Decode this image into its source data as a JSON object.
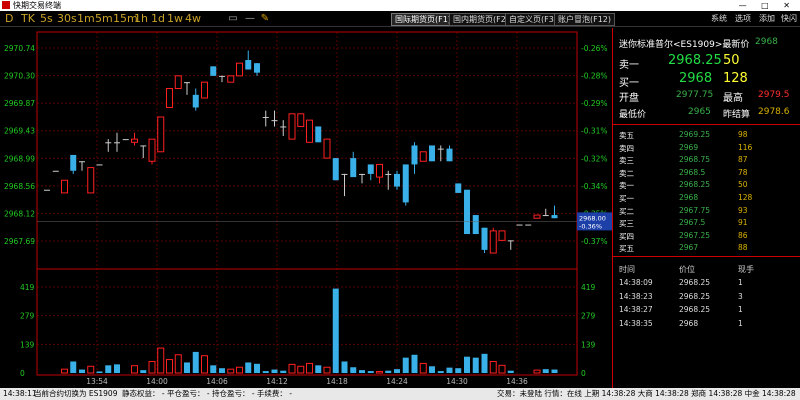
{
  "window": {
    "title": "快期交易终端",
    "controls": "— □ ✕"
  },
  "toolbar": {
    "periods": [
      "D",
      "TK",
      "5s",
      "30s",
      "1m",
      "5m",
      "15m",
      "1h",
      "1d",
      "1w",
      "4w"
    ],
    "tabs": [
      "国际期货页(F1)",
      "国内期货页(F2)",
      "自定义页(F3)",
      "账户冒泡(F12)"
    ],
    "active_tab": 0,
    "menu": [
      "系统",
      "选项",
      "添加",
      "快闪"
    ]
  },
  "chart_data": {
    "type": "candlestick",
    "times": [
      "13:54",
      "14:00",
      "14:06",
      "14:12",
      "14:18",
      "14:24",
      "14:30",
      "14:36"
    ],
    "price_axis": [
      "2970.74",
      "2970.30",
      "2969.87",
      "2969.43",
      "2968.99",
      "2968.56",
      "2968.12",
      "2967.69"
    ],
    "pct_axis": [
      "-0.26%",
      "-0.28%",
      "-0.29%",
      "-0.31%",
      "-0.32%",
      "-0.34%",
      "-0.35%",
      "-0.37%"
    ],
    "volume_axis": [
      "419",
      "279",
      "139",
      "0"
    ],
    "current_price_label": "2968.00",
    "current_pct_label": "-0.36%",
    "colors": {
      "up": "#ff2020",
      "down": "#3ab0e8",
      "flat": "#cccccc",
      "frame": "#c00000"
    },
    "candles": [
      {
        "o": 2968.5,
        "h": 2968.5,
        "l": 2968.5,
        "c": 2968.5,
        "v": 0
      },
      {
        "o": 2968.8,
        "h": 2968.8,
        "l": 2968.8,
        "c": 2968.8,
        "v": 0
      },
      {
        "o": 2968.45,
        "h": 2968.65,
        "l": 2968.45,
        "c": 2968.65,
        "v": 20
      },
      {
        "o": 2969.05,
        "h": 2969.05,
        "l": 2968.75,
        "c": 2968.8,
        "v": 60
      },
      {
        "o": 2968.95,
        "h": 2968.95,
        "l": 2968.8,
        "c": 2968.95,
        "v": 18
      },
      {
        "o": 2968.45,
        "h": 2968.85,
        "l": 2968.45,
        "c": 2968.85,
        "v": 35
      },
      {
        "o": 2968.9,
        "h": 2968.9,
        "l": 2968.9,
        "c": 2968.9,
        "v": 8
      },
      {
        "o": 2969.25,
        "h": 2969.3,
        "l": 2969.1,
        "c": 2969.25,
        "v": 40
      },
      {
        "o": 2969.25,
        "h": 2969.4,
        "l": 2969.1,
        "c": 2969.25,
        "v": 45
      },
      {
        "o": 2969.3,
        "h": 2969.3,
        "l": 2969.3,
        "c": 2969.3,
        "v": 0
      },
      {
        "o": 2969.25,
        "h": 2969.4,
        "l": 2969.2,
        "c": 2969.3,
        "v": 38
      },
      {
        "o": 2969.2,
        "h": 2969.2,
        "l": 2969.0,
        "c": 2969.2,
        "v": 15
      },
      {
        "o": 2968.95,
        "h": 2969.3,
        "l": 2968.9,
        "c": 2969.3,
        "v": 60
      },
      {
        "o": 2969.1,
        "h": 2969.65,
        "l": 2969.1,
        "c": 2969.65,
        "v": 130
      },
      {
        "o": 2969.8,
        "h": 2970.1,
        "l": 2969.8,
        "c": 2970.1,
        "v": 70
      },
      {
        "o": 2970.1,
        "h": 2970.3,
        "l": 2970.1,
        "c": 2970.3,
        "v": 95
      },
      {
        "o": 2970.2,
        "h": 2970.2,
        "l": 2970.0,
        "c": 2970.2,
        "v": 55
      },
      {
        "o": 2970.0,
        "h": 2970.1,
        "l": 2969.75,
        "c": 2969.8,
        "v": 110
      },
      {
        "o": 2969.95,
        "h": 2970.2,
        "l": 2969.95,
        "c": 2970.2,
        "v": 90
      },
      {
        "o": 2970.45,
        "h": 2970.45,
        "l": 2970.3,
        "c": 2970.3,
        "v": 40
      },
      {
        "o": 2970.3,
        "h": 2970.3,
        "l": 2970.2,
        "c": 2970.3,
        "v": 25
      },
      {
        "o": 2970.2,
        "h": 2970.3,
        "l": 2970.2,
        "c": 2970.3,
        "v": 20
      },
      {
        "o": 2970.3,
        "h": 2970.5,
        "l": 2970.3,
        "c": 2970.5,
        "v": 30
      },
      {
        "o": 2970.55,
        "h": 2970.7,
        "l": 2970.4,
        "c": 2970.4,
        "v": 55
      },
      {
        "o": 2970.5,
        "h": 2970.5,
        "l": 2970.3,
        "c": 2970.35,
        "v": 48
      },
      {
        "o": 2969.65,
        "h": 2969.75,
        "l": 2969.5,
        "c": 2969.65,
        "v": 10
      },
      {
        "o": 2969.6,
        "h": 2969.75,
        "l": 2969.5,
        "c": 2969.6,
        "v": 18
      },
      {
        "o": 2969.5,
        "h": 2969.6,
        "l": 2969.35,
        "c": 2969.5,
        "v": 12
      },
      {
        "o": 2969.3,
        "h": 2969.7,
        "l": 2969.3,
        "c": 2969.7,
        "v": 45
      },
      {
        "o": 2969.5,
        "h": 2969.7,
        "l": 2969.5,
        "c": 2969.7,
        "v": 35
      },
      {
        "o": 2969.25,
        "h": 2969.6,
        "l": 2969.25,
        "c": 2969.6,
        "v": 50
      },
      {
        "o": 2969.5,
        "h": 2969.5,
        "l": 2969.25,
        "c": 2969.25,
        "v": 40
      },
      {
        "o": 2969.0,
        "h": 2969.3,
        "l": 2969.0,
        "c": 2969.3,
        "v": 30
      },
      {
        "o": 2969.0,
        "h": 2969.0,
        "l": 2968.65,
        "c": 2968.65,
        "v": 440
      },
      {
        "o": 2968.75,
        "h": 2968.75,
        "l": 2968.4,
        "c": 2968.75,
        "v": 60
      },
      {
        "o": 2969.0,
        "h": 2969.1,
        "l": 2968.7,
        "c": 2968.7,
        "v": 30
      },
      {
        "o": 2968.75,
        "h": 2968.75,
        "l": 2968.6,
        "c": 2968.75,
        "v": 15
      },
      {
        "o": 2968.9,
        "h": 2968.9,
        "l": 2968.65,
        "c": 2968.75,
        "v": 10
      },
      {
        "o": 2968.7,
        "h": 2968.9,
        "l": 2968.6,
        "c": 2968.9,
        "v": 8
      },
      {
        "o": 2968.75,
        "h": 2968.8,
        "l": 2968.5,
        "c": 2968.75,
        "v": 12
      },
      {
        "o": 2968.75,
        "h": 2968.8,
        "l": 2968.5,
        "c": 2968.55,
        "v": 20
      },
      {
        "o": 2968.9,
        "h": 2968.9,
        "l": 2968.25,
        "c": 2968.3,
        "v": 80
      },
      {
        "o": 2969.2,
        "h": 2969.25,
        "l": 2968.75,
        "c": 2968.9,
        "v": 95
      },
      {
        "o": 2968.95,
        "h": 2969.1,
        "l": 2968.95,
        "c": 2969.1,
        "v": 50
      },
      {
        "o": 2969.2,
        "h": 2969.2,
        "l": 2968.95,
        "c": 2968.95,
        "v": 35
      },
      {
        "o": 2969.15,
        "h": 2969.2,
        "l": 2968.95,
        "c": 2969.15,
        "v": 10
      },
      {
        "o": 2969.15,
        "h": 2969.2,
        "l": 2968.95,
        "c": 2968.95,
        "v": 28
      },
      {
        "o": 2968.6,
        "h": 2968.6,
        "l": 2968.45,
        "c": 2968.45,
        "v": 25
      },
      {
        "o": 2968.5,
        "h": 2968.5,
        "l": 2967.8,
        "c": 2967.8,
        "v": 85
      },
      {
        "o": 2968.1,
        "h": 2968.1,
        "l": 2967.8,
        "c": 2967.8,
        "v": 80
      },
      {
        "o": 2967.9,
        "h": 2967.9,
        "l": 2967.5,
        "c": 2967.55,
        "v": 100
      },
      {
        "o": 2967.5,
        "h": 2967.9,
        "l": 2967.5,
        "c": 2967.85,
        "v": 60
      },
      {
        "o": 2967.7,
        "h": 2967.85,
        "l": 2967.7,
        "c": 2967.85,
        "v": 40
      },
      {
        "o": 2967.7,
        "h": 2967.7,
        "l": 2967.55,
        "c": 2967.7,
        "v": 12
      },
      {
        "o": 2967.95,
        "h": 2967.95,
        "l": 2967.95,
        "c": 2967.95,
        "v": 0
      },
      {
        "o": 2967.95,
        "h": 2967.95,
        "l": 2967.95,
        "c": 2967.95,
        "v": 0
      },
      {
        "o": 2968.05,
        "h": 2968.1,
        "l": 2968.05,
        "c": 2968.1,
        "v": 15
      },
      {
        "o": 2968.1,
        "h": 2968.2,
        "l": 2968.1,
        "c": 2968.1,
        "v": 20
      },
      {
        "o": 2968.1,
        "h": 2968.25,
        "l": 2968.05,
        "c": 2968.05,
        "v": 18
      }
    ]
  },
  "quote": {
    "title": "迷你标准普尔<ES1909>最新价",
    "last": "2968",
    "ask1_label": "卖一",
    "ask1_price": "2968.25",
    "ask1_vol": "50",
    "bid1_label": "买一",
    "bid1_price": "2968",
    "bid1_vol": "128",
    "open_label": "开盘",
    "open": "2977.75",
    "high_label": "最高",
    "high": "2979.5",
    "low_label": "最低价",
    "low": "2965",
    "settle_label": "昨结算",
    "settle": "2978.6",
    "depth": [
      {
        "label": "卖五",
        "price": "2969.25",
        "vol": "98"
      },
      {
        "label": "卖四",
        "price": "2969",
        "vol": "116"
      },
      {
        "label": "卖三",
        "price": "2968.75",
        "vol": "87"
      },
      {
        "label": "卖二",
        "price": "2968.5",
        "vol": "78"
      },
      {
        "label": "卖一",
        "price": "2968.25",
        "vol": "50"
      },
      {
        "label": "买一",
        "price": "2968",
        "vol": "128"
      },
      {
        "label": "买二",
        "price": "2967.75",
        "vol": "93"
      },
      {
        "label": "买三",
        "price": "2967.5",
        "vol": "91"
      },
      {
        "label": "买四",
        "price": "2967.25",
        "vol": "86"
      },
      {
        "label": "买五",
        "price": "2967",
        "vol": "88"
      }
    ],
    "trades_header": [
      "时间",
      "价位",
      "现手"
    ],
    "trades": [
      {
        "time": "14:38:09",
        "price": "2968.25",
        "vol": "1"
      },
      {
        "time": "14:38:23",
        "price": "2968.25",
        "vol": "3"
      },
      {
        "time": "14:38:27",
        "price": "2968.25",
        "vol": "1"
      },
      {
        "time": "14:38:35",
        "price": "2968",
        "vol": "1"
      }
    ]
  },
  "status": {
    "time": "14:38:11",
    "contract": "当前合约切换为 ES1909",
    "equity": "静态权益： - 平仓盈亏： - 持仓盈亏： - 手续费： -",
    "right": "交易：未登陆  行情：在线  上期 14:38:28  大商 14:38:28  郑商 14:38:28  中金 14:38:28"
  }
}
